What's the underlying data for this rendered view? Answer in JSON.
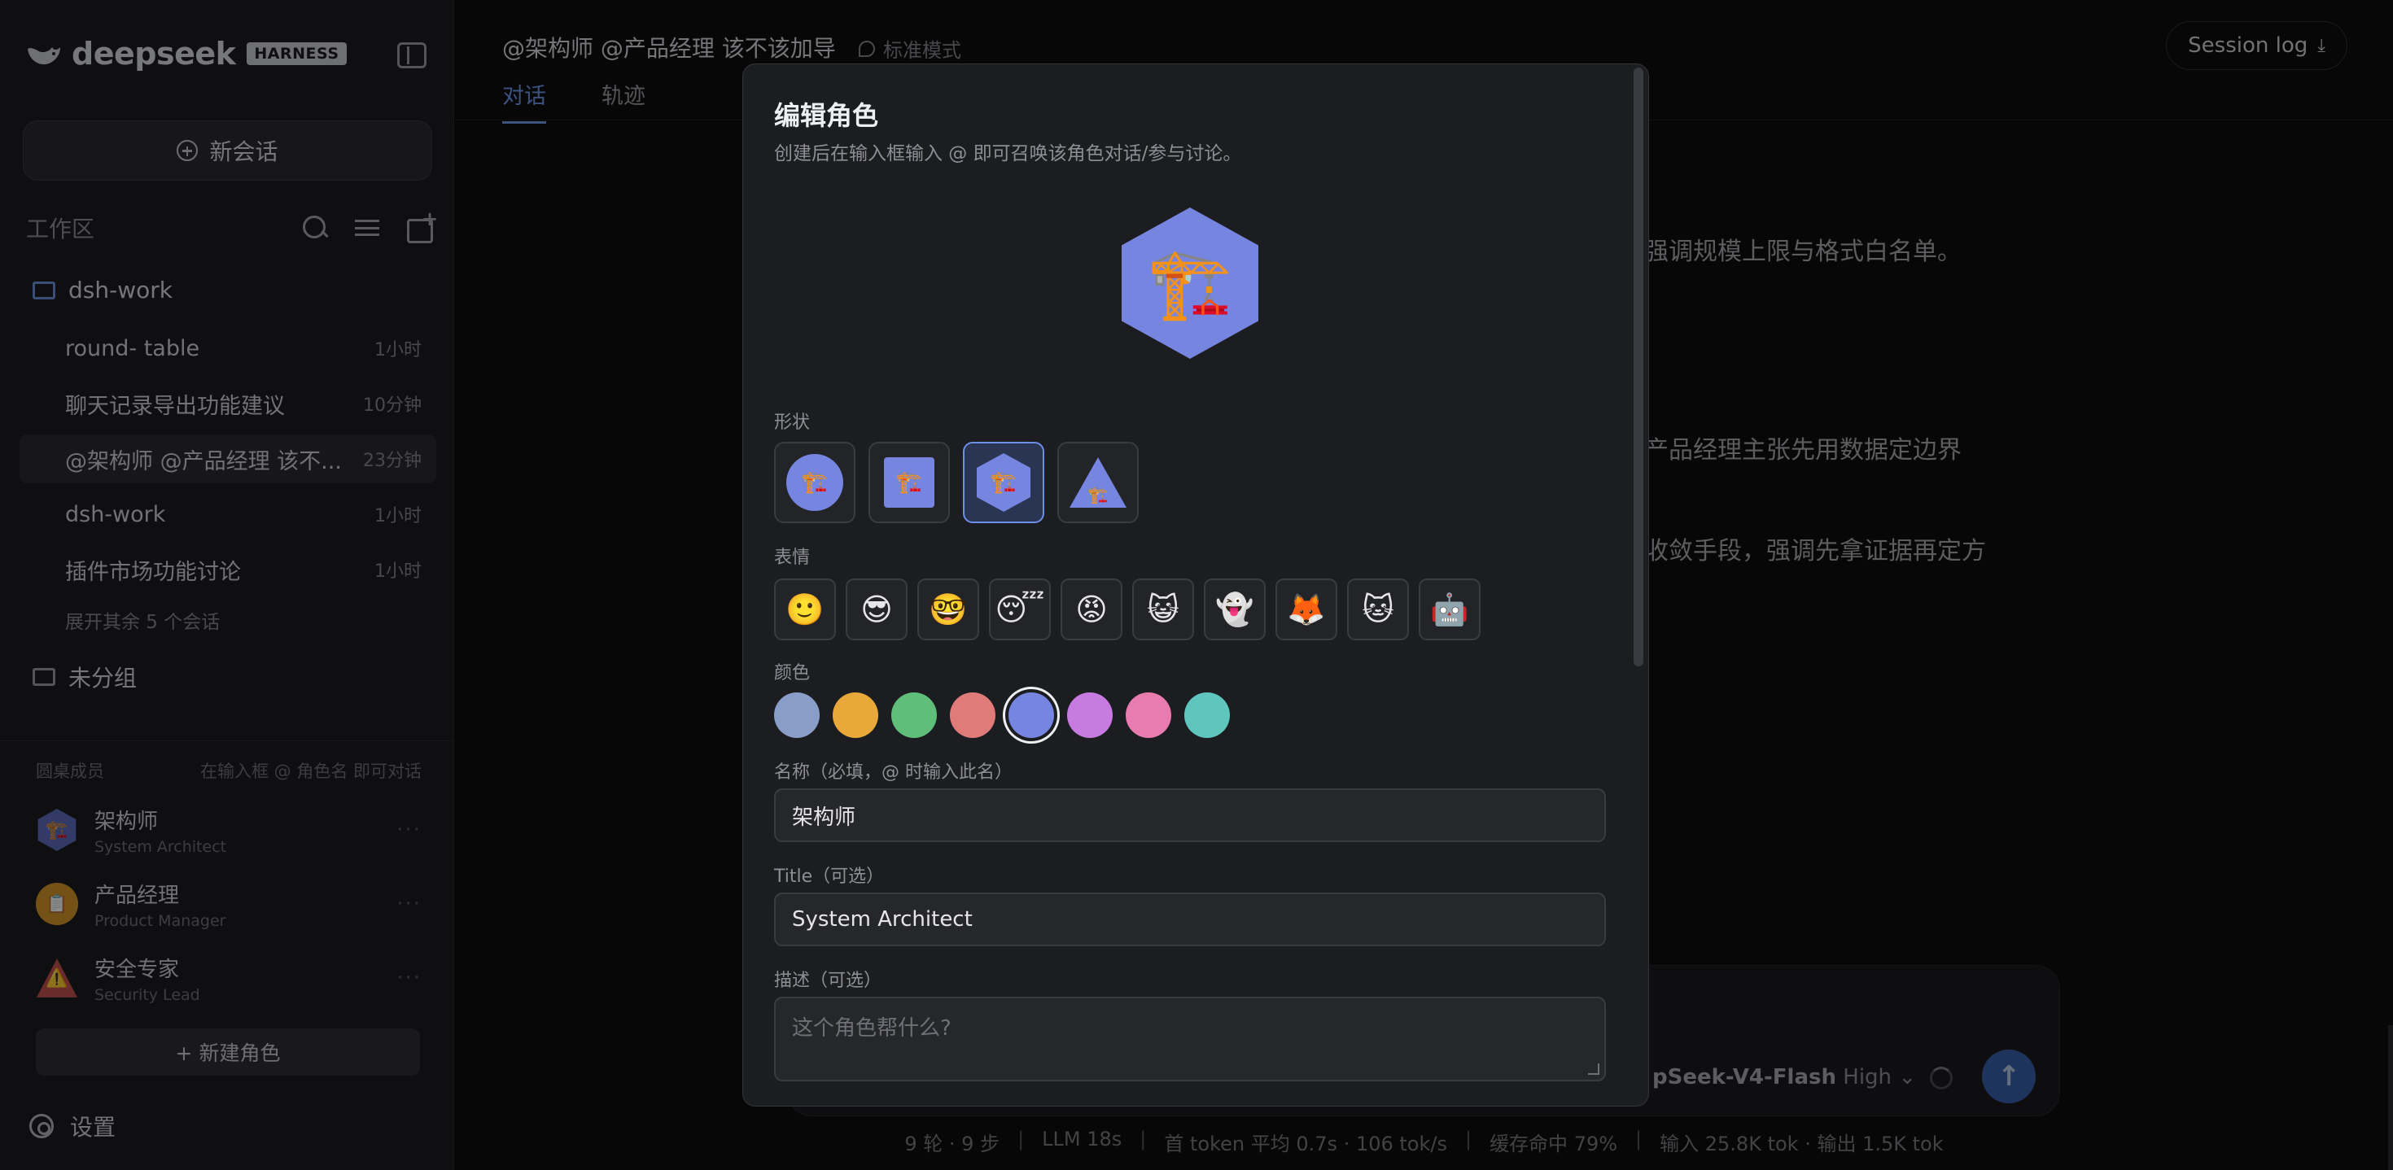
{
  "brand": {
    "name": "deepseek",
    "badge": "HARNESS"
  },
  "sidebar": {
    "new_chat": "新会话",
    "workspace_title": "工作区",
    "folder": "dsh-work",
    "sessions": [
      {
        "title": "round- table",
        "time": "1小时"
      },
      {
        "title": "聊天记录导出功能建议",
        "time": "10分钟"
      },
      {
        "title": "@架构师 @产品经理 该不...",
        "time": "23分钟"
      },
      {
        "title": "dsh-work",
        "time": "1小时"
      },
      {
        "title": "插件市场功能讨论",
        "time": "1小时"
      }
    ],
    "expand_more": "展开其余 5 个会话",
    "ungrouped": "未分组",
    "members_title": "圆桌成员",
    "members_hint": "在输入框 @ 角色名 即可对话",
    "members": [
      {
        "name": "架构师",
        "title": "System Architect"
      },
      {
        "name": "产品经理",
        "title": "Product Manager"
      },
      {
        "name": "安全专家",
        "title": "Security Lead"
      }
    ],
    "more": "···",
    "new_role": "+ 新建角色",
    "settings": "设置"
  },
  "main": {
    "conversation_title": "@架构师 @产品经理 该不该加导",
    "mode": "标准模式",
    "tabs": [
      "对话",
      "轨迹"
    ],
    "session_log": "Session log",
    "bg_lines": [
      "强调规模上限与格式白名单。",
      "产品经理主张先用数据定边界",
      "收敛手段，强调先拿证据再定方"
    ],
    "model_name": "pSeek-V4-Flash",
    "model_level": "High",
    "send_icon": "↑",
    "stats": [
      "9 轮 · 9 步",
      "LLM 18s",
      "首 token 平均 0.7s · 106 tok/s",
      "缓存命中 79%",
      "输入 25.8K tok · 输出 1.5K tok"
    ],
    "stats_sep": "|"
  },
  "modal": {
    "title": "编辑角色",
    "subtitle": "创建后在输入框输入 @ 即可召唤该角色对话/参与讨论。",
    "preview_icon": "🏗️",
    "shape_label": "形状",
    "shapes": [
      "circle",
      "square",
      "hexagon",
      "triangle"
    ],
    "selected_shape": "hexagon",
    "emoji_label": "表情",
    "emojis": [
      "🙂",
      "😎",
      "🤓",
      "😴",
      "😡",
      "😺",
      "👻",
      "🦊",
      "🐱",
      "🤖"
    ],
    "color_label": "颜色",
    "colors": [
      "#8a9cc8",
      "#e8a93a",
      "#5fbf7a",
      "#e07b79",
      "#7585e0",
      "#c77ae0",
      "#e87bb0",
      "#5fc6bd"
    ],
    "selected_color": "#7585e0",
    "name_label": "名称（必填，@ 时输入此名）",
    "name_value": "架构师",
    "title_label": "Title（可选）",
    "title_value": "System Architect",
    "desc_label": "描述（可选）",
    "desc_placeholder": "这个角色帮什么?"
  }
}
